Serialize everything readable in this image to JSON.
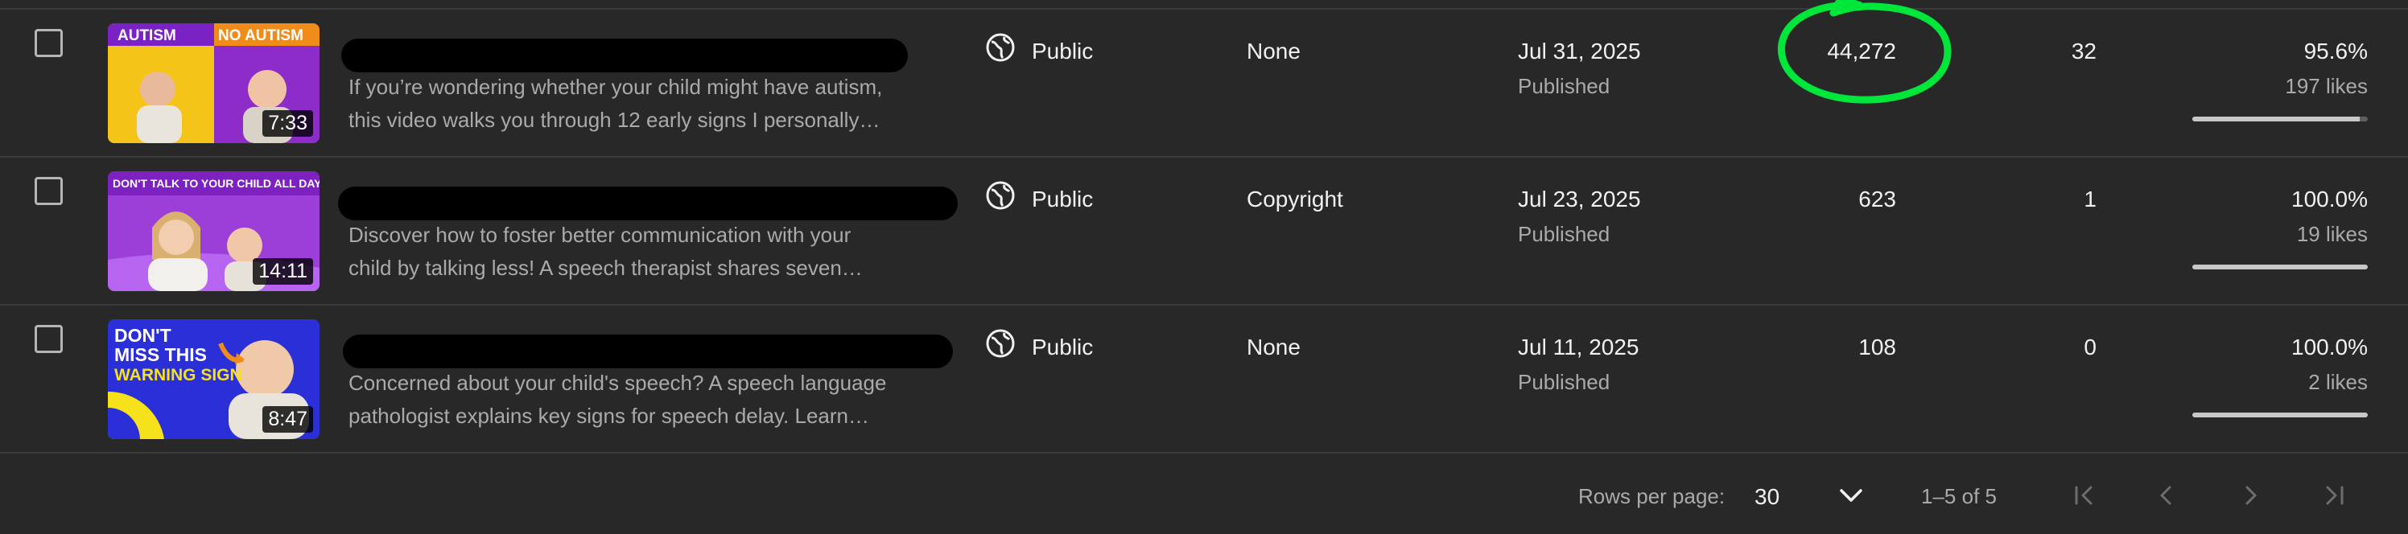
{
  "rows": [
    {
      "thumbnail": {
        "caption_left": "AUTISM",
        "caption_right": "NO AUTISM",
        "duration": "7:33"
      },
      "description_line1": "If you’re wondering whether your child might have autism,",
      "description_line2": "this video walks you through 12 early signs I personally…",
      "visibility": "Public",
      "restrictions": "None",
      "date": "Jul 31, 2025",
      "status": "Published",
      "views": "44,272",
      "comments": "32",
      "like_ratio": "95.6%",
      "likes": "197 likes",
      "like_fraction": 0.956
    },
    {
      "thumbnail": {
        "caption": "DON'T TALK TO YOUR CHILD ALL DAY",
        "duration": "14:11"
      },
      "description_line1": "Discover how to foster better communication with your",
      "description_line2": "child by talking less! A speech therapist shares seven…",
      "visibility": "Public",
      "restrictions": "Copyright",
      "date": "Jul 23, 2025",
      "status": "Published",
      "views": "623",
      "comments": "1",
      "like_ratio": "100.0%",
      "likes": "19 likes",
      "like_fraction": 1.0
    },
    {
      "thumbnail": {
        "caption_line1": "DON'T",
        "caption_line2": "MISS THIS",
        "caption_line3": "WARNING SIGN",
        "duration": "8:47"
      },
      "description_line1": "Concerned about your child's speech? A speech language",
      "description_line2": "pathologist explains key signs for speech delay. Learn…",
      "visibility": "Public",
      "restrictions": "None",
      "date": "Jul 11, 2025",
      "status": "Published",
      "views": "108",
      "comments": "0",
      "like_ratio": "100.0%",
      "likes": "2 likes",
      "like_fraction": 1.0
    }
  ],
  "pagination": {
    "rows_per_page_label": "Rows per page:",
    "rows_per_page_value": "30",
    "range": "1–5 of 5"
  },
  "icons": {
    "visibility": "globe-icon",
    "dropdown": "chevron-down-icon",
    "first": "first-page-icon",
    "prev": "chevron-left-icon",
    "next": "chevron-right-icon",
    "last": "last-page-icon"
  },
  "colors": {
    "background": "#282828",
    "annotation": "#00e63a"
  }
}
